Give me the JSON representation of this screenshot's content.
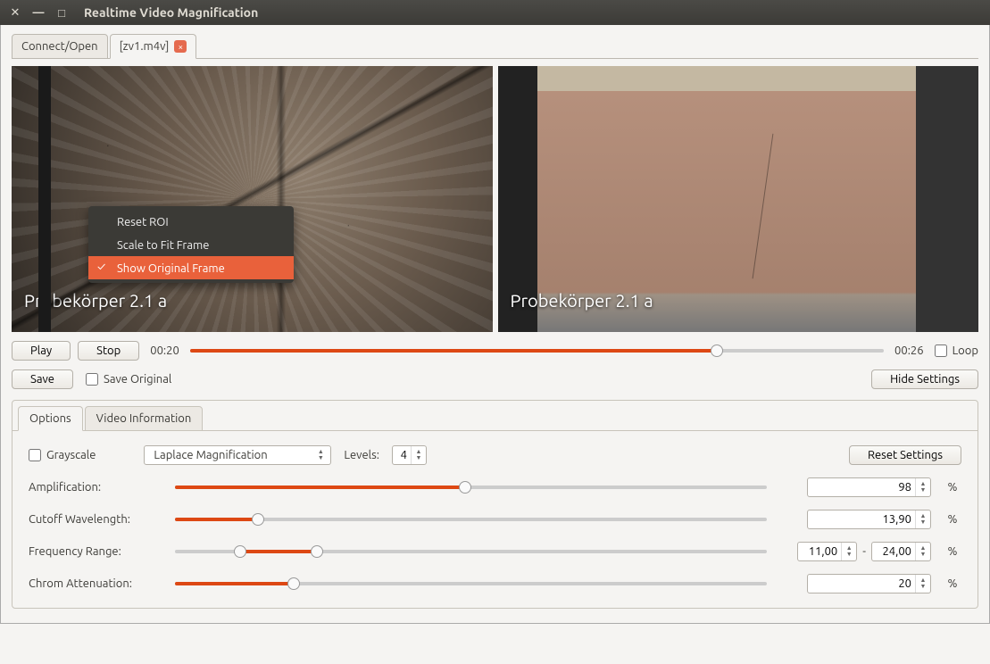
{
  "titlebar": {
    "title": "Realtime Video Magnification"
  },
  "tabs": {
    "connect": "Connect/Open",
    "file": "[zv1.m4v]"
  },
  "caption": "Probekörper 2.1 a",
  "context_menu": {
    "reset_roi": "Reset ROI",
    "scale_fit": "Scale to Fit Frame",
    "show_original": "Show Original Frame"
  },
  "transport": {
    "play": "Play",
    "stop": "Stop",
    "current": "00:20",
    "total": "00:26",
    "loop": "Loop",
    "progress_pct": 76
  },
  "save": {
    "save": "Save",
    "save_original": "Save Original",
    "hide_settings": "Hide Settings"
  },
  "panel_tabs": {
    "options": "Options",
    "video_info": "Video Information"
  },
  "options": {
    "grayscale": "Grayscale",
    "method": "Laplace Magnification",
    "levels_label": "Levels:",
    "levels": "4",
    "reset": "Reset Settings",
    "amplification": {
      "label": "Amplification:",
      "value": "98",
      "pct": 49
    },
    "cutoff": {
      "label": "Cutoff Wavelength:",
      "value": "13,90",
      "pct": 14
    },
    "freq": {
      "label": "Frequency Range:",
      "lo": "11,00",
      "hi": "24,00",
      "lo_pct": 11,
      "hi_pct": 24
    },
    "chrom": {
      "label": "Chrom Attenuation:",
      "value": "20",
      "pct": 20
    },
    "dash": "-",
    "percent": "%"
  }
}
